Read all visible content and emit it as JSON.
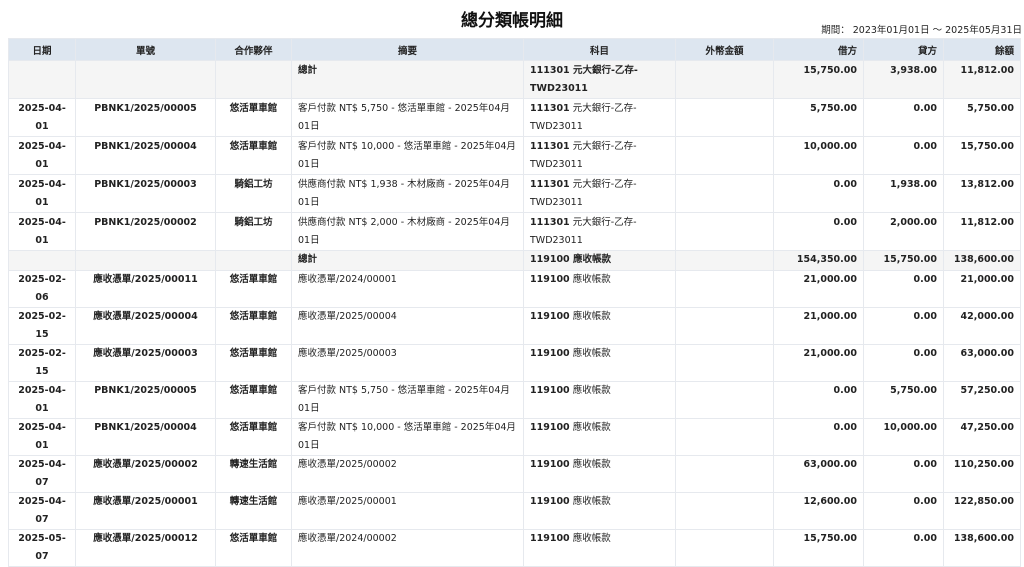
{
  "report": {
    "title": "總分類帳明細",
    "period": "期間： 2023年01月01日 ～ 2025年05月31日"
  },
  "columns": {
    "date": "日期",
    "voucher": "單號",
    "partner": "合作夥伴",
    "memo": "摘要",
    "account": "科目",
    "fx_amount": "外幣金額",
    "debit": "借方",
    "credit": "貸方",
    "balance": "餘額"
  },
  "rows": [
    {
      "date": "",
      "voucher": "",
      "partner": "",
      "memo": "總計",
      "account_code": "111301",
      "account_name": " 元大銀行-乙存-TWD23011",
      "fx": "",
      "debit": "15,750.00",
      "credit": "3,938.00",
      "balance": "11,812.00"
    },
    {
      "date": "2025-04-01",
      "voucher": "PBNK1/2025/00005",
      "partner": "悠活單車館",
      "memo": "客戶付款 NT$ 5,750 - 悠活單車館 - 2025年04月01日",
      "account_code": "111301",
      "account_name": " 元大銀行-乙存-TWD23011",
      "fx": "",
      "debit": "5,750.00",
      "credit": "0.00",
      "balance": "5,750.00"
    },
    {
      "date": "2025-04-01",
      "voucher": "PBNK1/2025/00004",
      "partner": "悠活單車館",
      "memo": "客戶付款 NT$ 10,000 - 悠活單車館 - 2025年04月01日",
      "account_code": "111301",
      "account_name": " 元大銀行-乙存-TWD23011",
      "fx": "",
      "debit": "10,000.00",
      "credit": "0.00",
      "balance": "15,750.00"
    },
    {
      "date": "2025-04-01",
      "voucher": "PBNK1/2025/00003",
      "partner": "騎鋁工坊",
      "memo": "供應商付款 NT$ 1,938 - 木材廠商 - 2025年04月01日",
      "account_code": "111301",
      "account_name": " 元大銀行-乙存-TWD23011",
      "fx": "",
      "debit": "0.00",
      "credit": "1,938.00",
      "balance": "13,812.00"
    },
    {
      "date": "2025-04-01",
      "voucher": "PBNK1/2025/00002",
      "partner": "騎鋁工坊",
      "memo": "供應商付款 NT$ 2,000 - 木材廠商 - 2025年04月01日",
      "account_code": "111301",
      "account_name": " 元大銀行-乙存-TWD23011",
      "fx": "",
      "debit": "0.00",
      "credit": "2,000.00",
      "balance": "11,812.00"
    },
    {
      "date": "",
      "voucher": "",
      "partner": "",
      "memo": "總計",
      "account_code": "119100",
      "account_name": " 應收帳款",
      "fx": "",
      "debit": "154,350.00",
      "credit": "15,750.00",
      "balance": "138,600.00"
    },
    {
      "date": "2025-02-06",
      "voucher": "應收憑單/2025/00011",
      "partner": "悠活單車館",
      "memo": "應收憑單/2024/00001",
      "account_code": "119100",
      "account_name": " 應收帳款",
      "fx": "",
      "debit": "21,000.00",
      "credit": "0.00",
      "balance": "21,000.00"
    },
    {
      "date": "2025-02-15",
      "voucher": "應收憑單/2025/00004",
      "partner": "悠活單車館",
      "memo": "應收憑單/2025/00004",
      "account_code": "119100",
      "account_name": " 應收帳款",
      "fx": "",
      "debit": "21,000.00",
      "credit": "0.00",
      "balance": "42,000.00"
    },
    {
      "date": "2025-02-15",
      "voucher": "應收憑單/2025/00003",
      "partner": "悠活單車館",
      "memo": "應收憑單/2025/00003",
      "account_code": "119100",
      "account_name": " 應收帳款",
      "fx": "",
      "debit": "21,000.00",
      "credit": "0.00",
      "balance": "63,000.00"
    },
    {
      "date": "2025-04-01",
      "voucher": "PBNK1/2025/00005",
      "partner": "悠活單車館",
      "memo": "客戶付款 NT$ 5,750 - 悠活單車館 - 2025年04月01日",
      "account_code": "119100",
      "account_name": " 應收帳款",
      "fx": "",
      "debit": "0.00",
      "credit": "5,750.00",
      "balance": "57,250.00"
    },
    {
      "date": "2025-04-01",
      "voucher": "PBNK1/2025/00004",
      "partner": "悠活單車館",
      "memo": "客戶付款 NT$ 10,000 - 悠活單車館 - 2025年04月01日",
      "account_code": "119100",
      "account_name": " 應收帳款",
      "fx": "",
      "debit": "0.00",
      "credit": "10,000.00",
      "balance": "47,250.00"
    },
    {
      "date": "2025-04-07",
      "voucher": "應收憑單/2025/00002",
      "partner": "轉速生活館",
      "memo": "應收憑單/2025/00002",
      "account_code": "119100",
      "account_name": " 應收帳款",
      "fx": "",
      "debit": "63,000.00",
      "credit": "0.00",
      "balance": "110,250.00"
    },
    {
      "date": "2025-04-07",
      "voucher": "應收憑單/2025/00001",
      "partner": "轉速生活館",
      "memo": "應收憑單/2025/00001",
      "account_code": "119100",
      "account_name": " 應收帳款",
      "fx": "",
      "debit": "12,600.00",
      "credit": "0.00",
      "balance": "122,850.00"
    },
    {
      "date": "2025-05-07",
      "voucher": "應收憑單/2025/00012",
      "partner": "悠活單車館",
      "memo": "應收憑單/2024/00002",
      "account_code": "119100",
      "account_name": " 應收帳款",
      "fx": "",
      "debit": "15,750.00",
      "credit": "0.00",
      "balance": "138,600.00"
    }
  ]
}
